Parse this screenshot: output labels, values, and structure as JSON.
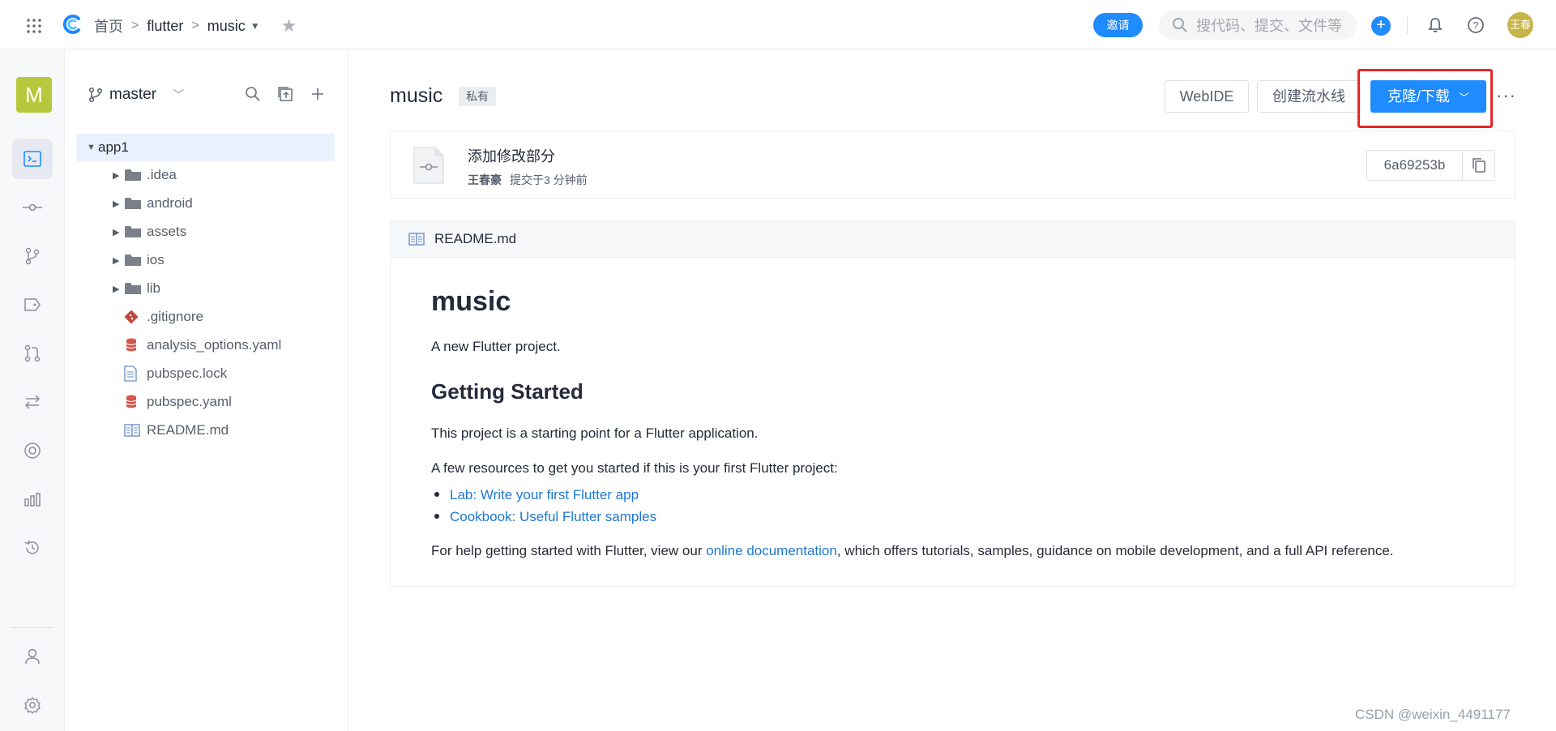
{
  "topbar": {
    "breadcrumb": [
      "首页",
      "flutter",
      "music"
    ],
    "invite_label": "邀请",
    "search_placeholder": "搜代码、提交、文件等",
    "avatar_text": "王春"
  },
  "leftnav": {
    "project_badge": "M",
    "items": [
      "code-icon",
      "commit-icon",
      "branch-icon",
      "tag-icon",
      "merge-request-icon",
      "compare-icon",
      "activity-icon",
      "stats-icon",
      "history-icon",
      "members-icon",
      "settings-icon"
    ]
  },
  "tree": {
    "branch": "master",
    "root": "app1",
    "nodes": [
      {
        "name": ".idea",
        "type": "folder"
      },
      {
        "name": "android",
        "type": "folder"
      },
      {
        "name": "assets",
        "type": "folder"
      },
      {
        "name": "ios",
        "type": "folder"
      },
      {
        "name": "lib",
        "type": "folder"
      },
      {
        "name": ".gitignore",
        "type": "git"
      },
      {
        "name": "analysis_options.yaml",
        "type": "yaml"
      },
      {
        "name": "pubspec.lock",
        "type": "text"
      },
      {
        "name": "pubspec.yaml",
        "type": "yaml"
      },
      {
        "name": "README.md",
        "type": "readme"
      }
    ]
  },
  "repo": {
    "name": "music",
    "visibility": "私有",
    "webide_label": "WebIDE",
    "pipeline_label": "创建流水线",
    "clone_label": "克隆/下载",
    "more": "···"
  },
  "commit": {
    "message": "添加修改部分",
    "author": "王春豪",
    "time": "提交于3 分钟前",
    "hash": "6a69253b"
  },
  "readme": {
    "filename": "README.md",
    "h1": "music",
    "intro": "A new Flutter project.",
    "h2": "Getting Started",
    "p1": "This project is a starting point for a Flutter application.",
    "p2": "A few resources to get you started if this is your first Flutter project:",
    "links": [
      "Lab: Write your first Flutter app",
      "Cookbook: Useful Flutter samples"
    ],
    "p3_before": "For help getting started with Flutter, view our ",
    "p3_link": "online documentation",
    "p3_after": ", which offers tutorials, samples, guidance on mobile development, and a full API reference."
  },
  "watermark": "CSDN @weixin_4491177"
}
